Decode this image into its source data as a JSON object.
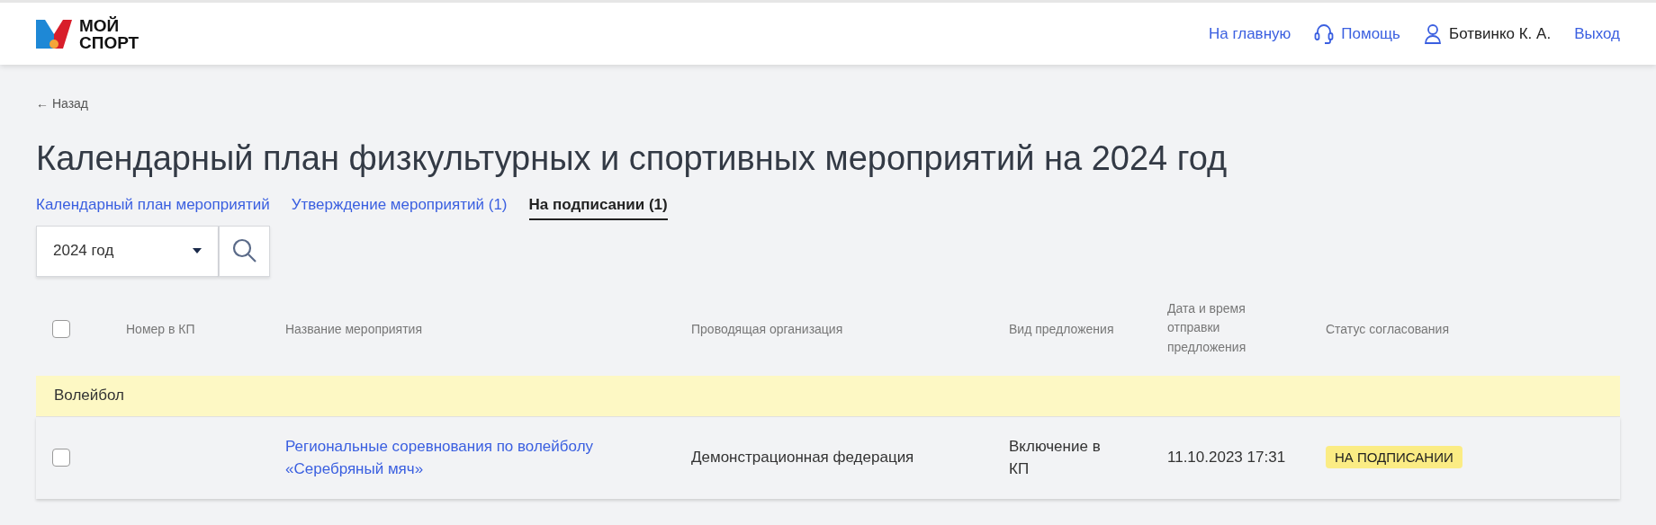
{
  "header": {
    "logo": {
      "line1": "МОЙ",
      "line2": "СПОРТ"
    },
    "nav": [
      {
        "kind": "link",
        "label": "На главную"
      },
      {
        "kind": "help",
        "label": "Помощь"
      },
      {
        "kind": "user",
        "label": "Ботвинко К. А."
      },
      {
        "kind": "link",
        "label": "Выход"
      }
    ]
  },
  "back": "← Назад",
  "title": "Календарный план физкультурных и спортивных мероприятий на 2024 год",
  "tabs": [
    {
      "label": "Календарный план мероприятий",
      "selected": false
    },
    {
      "label": "Утверждение мероприятий (1)",
      "selected": false
    },
    {
      "label": "На подписании (1)",
      "selected": true
    }
  ],
  "year_select": {
    "value": "2024 год"
  },
  "table": {
    "select_all": {
      "checked": false
    },
    "columns": [
      "Номер в КП",
      "Название мероприятия",
      "Проводящая организация",
      "Вид предложения",
      "Дата и время отправки предложения",
      "Статус согласования"
    ],
    "groups": [
      {
        "name": "Волейбол",
        "rows": [
          {
            "checked": false,
            "number": "",
            "name": "Региональные соревнования по волейболу «Серебряный мяч»",
            "organization": "Демонстрационная федерация",
            "proposal_type": "Включение в КП",
            "sent": "11.10.2023 17:31",
            "status": "НА ПОДПИСАНИИ"
          }
        ]
      }
    ]
  }
}
